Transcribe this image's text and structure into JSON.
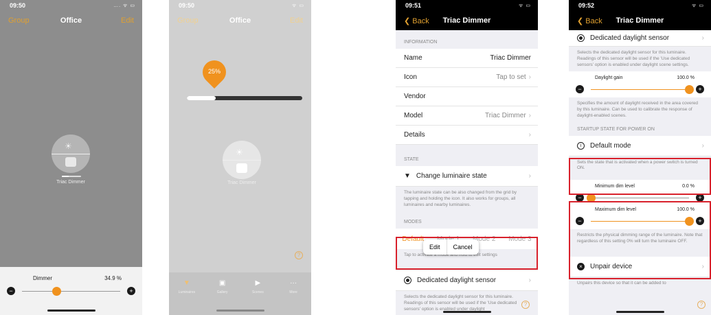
{
  "screen1": {
    "time": "09:50",
    "signal": "…. ᯤ ▭",
    "nav_left": "Group",
    "title": "Office",
    "nav_right": "Edit",
    "luminaire_label": "Triac Dimmer",
    "dimmer_label": "Dimmer",
    "dimmer_value": "34.9 %",
    "dimmer_fraction": 0.349
  },
  "screen2": {
    "time": "09:50",
    "signal": "ᯤ ▭",
    "nav_left": "Group",
    "title": "Office",
    "nav_right": "Edit",
    "pin_value": "25%",
    "level_fraction": 0.25,
    "luminaire_label": "Triac Dimmer",
    "tabs": [
      {
        "label": "Luminaires",
        "icon": "lamp-icon"
      },
      {
        "label": "Gallery",
        "icon": "gallery-icon"
      },
      {
        "label": "Scenes",
        "icon": "scenes-icon"
      },
      {
        "label": "More",
        "icon": "more-icon"
      }
    ]
  },
  "screen3": {
    "time": "09:51",
    "signal": "ᯤ ▭",
    "back": "Back",
    "title": "Triac Dimmer",
    "information_header": "INFORMATION",
    "name_label": "Name",
    "name_value": "Triac Dimmer",
    "icon_label": "Icon",
    "icon_value": "Tap to set",
    "vendor_label": "Vendor",
    "model_label": "Model",
    "model_value": "Triac Dimmer",
    "details_label": "Details",
    "state_header": "STATE",
    "change_state": "Change luminaire state",
    "state_note": "The luminaire state can be also changed from the grid by tapping and holding the icon. It also works for groups, all luminaires and nearby luminaires.",
    "modes_header": "MODES",
    "popup_edit": "Edit",
    "popup_cancel": "Cancel",
    "modes": [
      "Default",
      "Mode 1",
      "Mode 2",
      "Mode 3"
    ],
    "modes_note": "Tap to activate a mode and hold to edit settings",
    "daylight_sensor": "Dedicated daylight sensor",
    "daylight_note": "Selects the dedicated daylight sensor for this luminaire. Readings of this sensor will be used if the 'Use dedicated sensors' option is enabled under daylight"
  },
  "screen4": {
    "time": "09:52",
    "signal": "ᯤ ▭",
    "back": "Back",
    "title": "Triac Dimmer",
    "daylight_sensor": "Dedicated daylight sensor",
    "daylight_note": "Selects the dedicated daylight sensor for this luminaire. Readings of this sensor will be used if the 'Use dedicated sensors' option is enabled under daylight scene settings.",
    "gain_label": "Daylight gain",
    "gain_value": "100.0 %",
    "gain_fraction": 1.0,
    "gain_note": "Specifies the amount of daylight received in the area covered by this luminaire. Can be used to calibrate the response of daylight-enabled scenes.",
    "startup_header": "STARTUP STATE FOR POWER ON",
    "default_mode": "Default mode",
    "default_note": "Sets the state that is activated when a power switch is turned ON.",
    "min_label": "Minimum dim level",
    "min_value": "0.0 %",
    "min_fraction": 0.0,
    "max_label": "Maximum dim level",
    "max_value": "100.0 %",
    "max_fraction": 1.0,
    "range_note": "Restricts the physical dimming range of the luminaire. Note that regardless of this setting 0% will turn the luminaire OFF.",
    "unpair": "Unpair device",
    "unpair_note": "Unpairs this device so that it can be added to"
  },
  "colors": {
    "accent": "#f0921e",
    "highlight": "#d8202b"
  }
}
